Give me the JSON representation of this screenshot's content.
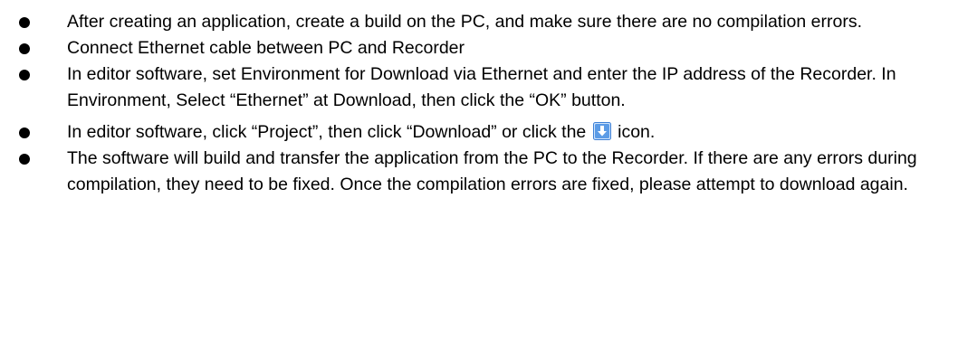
{
  "bullets": [
    {
      "text": "After creating an application, create a build on the PC, and make sure there are no compilation errors."
    },
    {
      "text": "Connect Ethernet cable between PC and Recorder"
    },
    {
      "text": "In editor software, set Environment for Download via Ethernet and enter the IP address of the Recorder. In Environment, Select “Ethernet” at Download, then click the “OK” button."
    },
    {
      "text_before_icon": "In editor software, click “Project”, then click “Download” or click the",
      "icon": "download-icon",
      "text_after_icon": "icon."
    },
    {
      "text": "The software will build and transfer the application from the PC to the Recorder. If there are any errors during compilation, they need to be fixed. Once the compilation errors are fixed, please attempt to download again."
    }
  ],
  "colors": {
    "text": "#000000",
    "icon_blue": "#3b7fd6",
    "icon_light": "#cfe3fb"
  }
}
